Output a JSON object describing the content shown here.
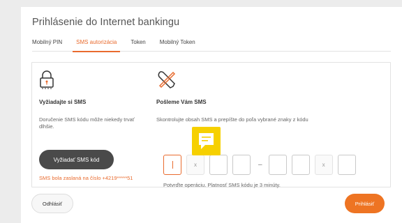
{
  "page": {
    "title": "Prihlásenie do Internet bankingu"
  },
  "tabs": [
    {
      "label": "Mobilný PIN",
      "active": false
    },
    {
      "label": "SMS autorizácia",
      "active": true
    },
    {
      "label": "Token",
      "active": false
    },
    {
      "label": "Mobilný Token",
      "active": false
    }
  ],
  "left": {
    "icon": "padlock-icon",
    "heading": "Vyžiadajte si SMS",
    "description": "Doručenie SMS kódu môže niekedy trvať dlhšie.",
    "button_label": "Vyžiadať SMS kód",
    "sent_note": "SMS bola zaslaná na číslo +4219*****51"
  },
  "right": {
    "icon": "tools-icon",
    "heading": "Pošleme Vám SMS",
    "description": "Skontrolujte obsah SMS a prepíšte do poľa vybrané znaky z kódu",
    "fixed_char": "x",
    "separator": "–",
    "confirm_note": "Potvrďte operáciu. Platnosť SMS kódu je 3 minúty."
  },
  "footer": {
    "cancel_label": "Odhlásiť",
    "login_label": "Prihlásiť"
  },
  "colors": {
    "accent": "#e96b2e",
    "primary_button": "#ee7423",
    "dark_button": "#4a4a4a",
    "chat_bubble": "#f6d000"
  },
  "chat": {
    "icon": "chat-bubble-icon"
  }
}
